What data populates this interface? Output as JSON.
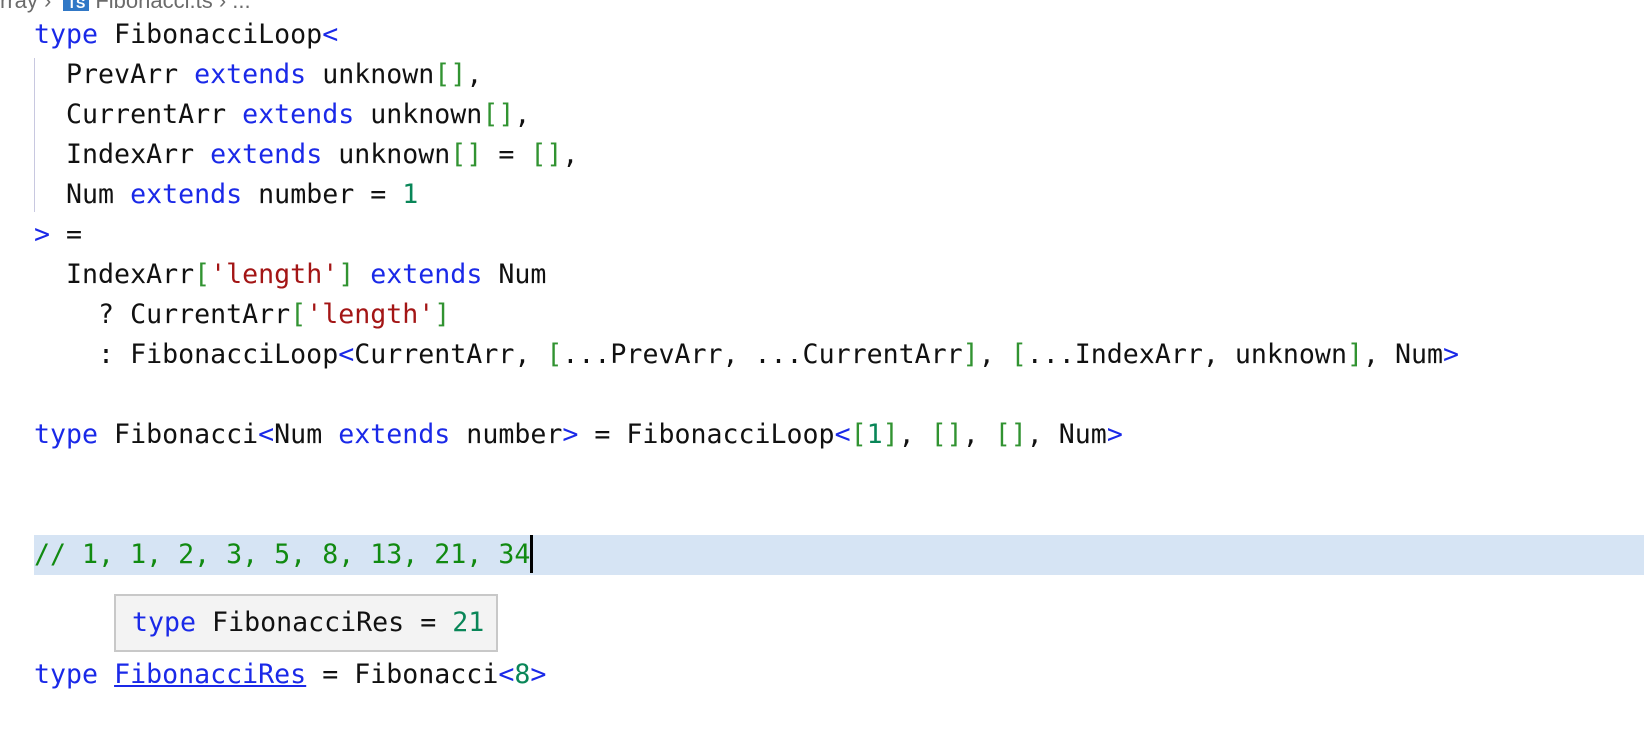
{
  "breadcrumb": {
    "parent": "rray",
    "file_badge": "TS",
    "file": "Fibonacci.ts",
    "more": "..."
  },
  "colors": {
    "keyword": "#1a29e8",
    "bracket": "#319331",
    "string": "#a31515",
    "number": "#098658",
    "comment": "#118a11",
    "current_line": "#d6e4f4"
  },
  "code": {
    "current_line": 13,
    "lines": [
      [
        [
          "kw",
          "type"
        ],
        [
          "tx",
          " FibonacciLoop"
        ],
        [
          "kw",
          "<"
        ]
      ],
      [
        [
          "tx",
          "  PrevArr "
        ],
        [
          "kw",
          "extends"
        ],
        [
          "tx",
          " unknown"
        ],
        [
          "br",
          "[]"
        ],
        [
          "tx",
          ","
        ]
      ],
      [
        [
          "tx",
          "  CurrentArr "
        ],
        [
          "kw",
          "extends"
        ],
        [
          "tx",
          " unknown"
        ],
        [
          "br",
          "[]"
        ],
        [
          "tx",
          ","
        ]
      ],
      [
        [
          "tx",
          "  IndexArr "
        ],
        [
          "kw",
          "extends"
        ],
        [
          "tx",
          " unknown"
        ],
        [
          "br",
          "[]"
        ],
        [
          "tx",
          " = "
        ],
        [
          "br",
          "[]"
        ],
        [
          "tx",
          ","
        ]
      ],
      [
        [
          "tx",
          "  Num "
        ],
        [
          "kw",
          "extends"
        ],
        [
          "tx",
          " number = "
        ],
        [
          "num",
          "1"
        ]
      ],
      [
        [
          "kw",
          ">"
        ],
        [
          "tx",
          " ="
        ]
      ],
      [
        [
          "tx",
          "  IndexArr"
        ],
        [
          "br",
          "["
        ],
        [
          "str",
          "'length'"
        ],
        [
          "br",
          "]"
        ],
        [
          "tx",
          " "
        ],
        [
          "kw",
          "extends"
        ],
        [
          "tx",
          " Num"
        ]
      ],
      [
        [
          "tx",
          "    ? CurrentArr"
        ],
        [
          "br",
          "["
        ],
        [
          "str",
          "'length'"
        ],
        [
          "br",
          "]"
        ]
      ],
      [
        [
          "tx",
          "    : FibonacciLoop"
        ],
        [
          "kw",
          "<"
        ],
        [
          "tx",
          "CurrentArr, "
        ],
        [
          "br",
          "["
        ],
        [
          "tx",
          "...PrevArr, ...CurrentArr"
        ],
        [
          "br",
          "]"
        ],
        [
          "tx",
          ", "
        ],
        [
          "br",
          "["
        ],
        [
          "tx",
          "...IndexArr, unknown"
        ],
        [
          "br",
          "]"
        ],
        [
          "tx",
          ", Num"
        ],
        [
          "kw",
          ">"
        ]
      ],
      [],
      [
        [
          "kw",
          "type"
        ],
        [
          "tx",
          " Fibonacci"
        ],
        [
          "kw",
          "<"
        ],
        [
          "tx",
          "Num "
        ],
        [
          "kw",
          "extends"
        ],
        [
          "tx",
          " number"
        ],
        [
          "kw",
          ">"
        ],
        [
          "tx",
          " = FibonacciLoop"
        ],
        [
          "kw",
          "<"
        ],
        [
          "br",
          "["
        ],
        [
          "num",
          "1"
        ],
        [
          "br",
          "]"
        ],
        [
          "tx",
          ", "
        ],
        [
          "br",
          "[]"
        ],
        [
          "tx",
          ", "
        ],
        [
          "br",
          "[]"
        ],
        [
          "tx",
          ", Num"
        ],
        [
          "kw",
          ">"
        ]
      ],
      [],
      [],
      [
        [
          "cm",
          "// 1, 1, 2, 3, 5, 8, 13, 21, 34"
        ]
      ],
      [],
      [],
      [
        [
          "kw",
          "type"
        ],
        [
          "tx",
          " "
        ],
        [
          "link",
          "FibonacciRes"
        ],
        [
          "tx",
          " = Fibonacci"
        ],
        [
          "kw",
          "<"
        ],
        [
          "num",
          "8"
        ],
        [
          "kw",
          ">"
        ]
      ]
    ]
  },
  "hover_tooltip": {
    "keyword": "type",
    "name": " FibonacciRes = ",
    "value": "21"
  }
}
